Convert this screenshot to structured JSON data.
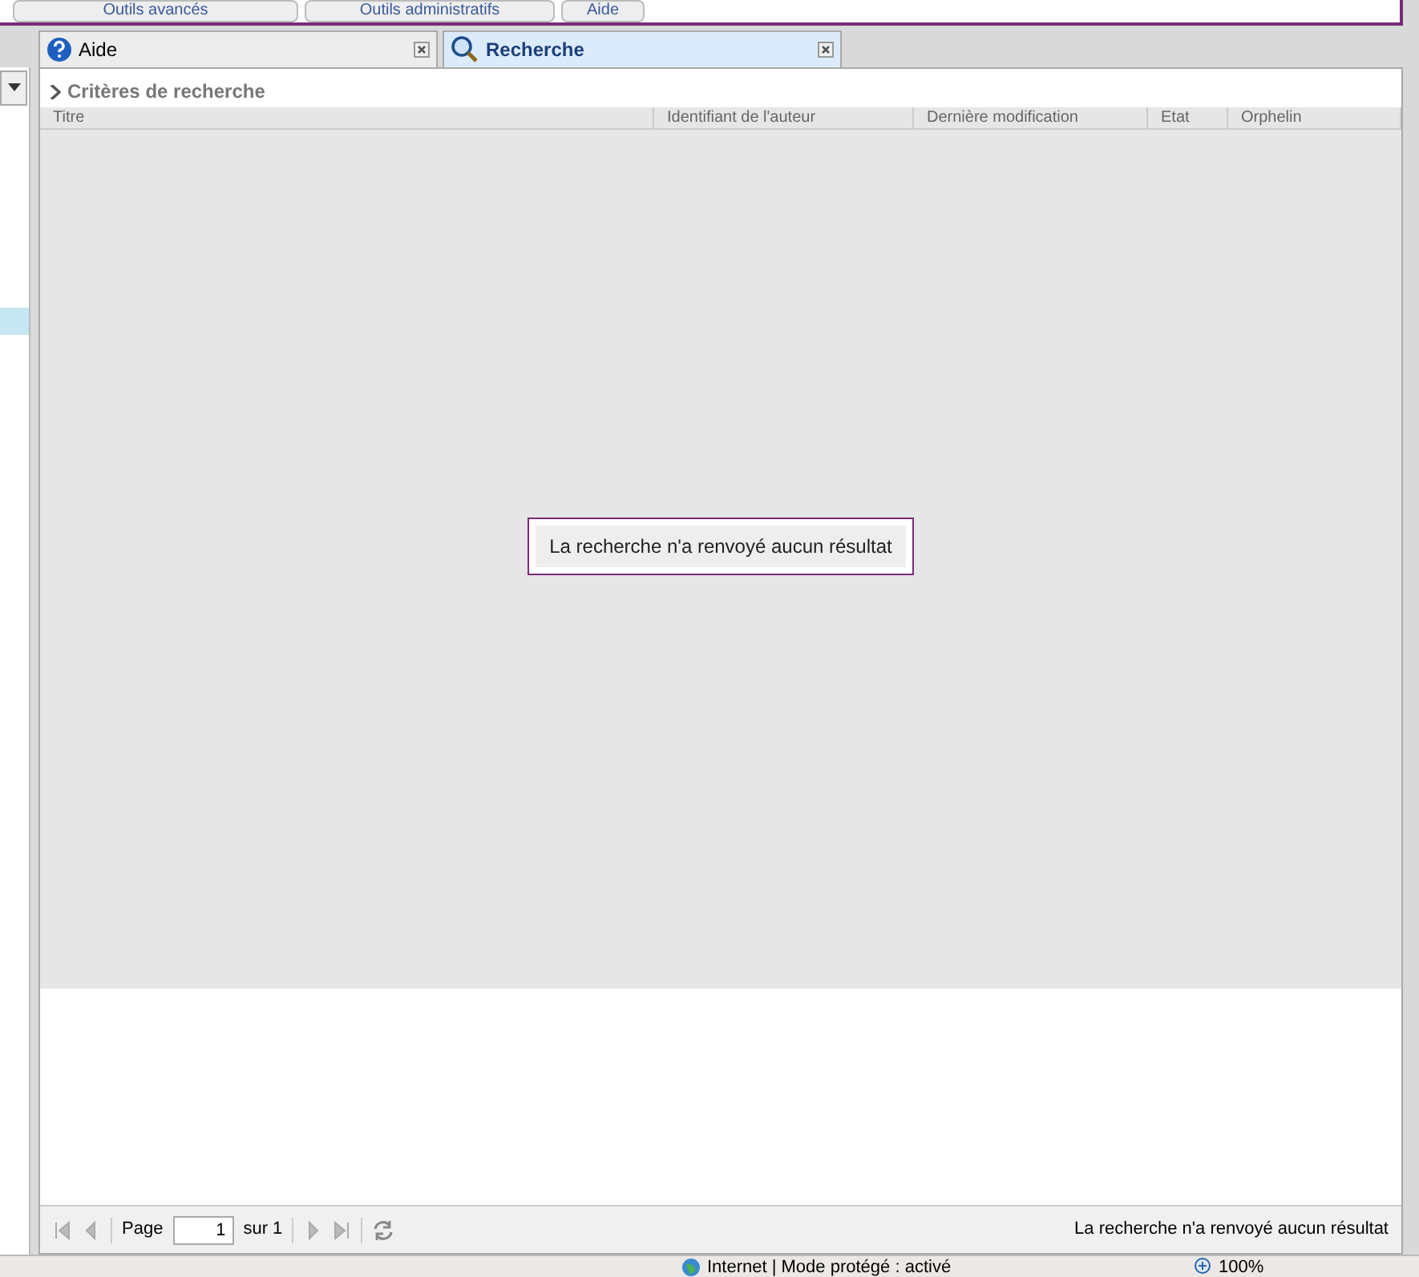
{
  "toolbar": {
    "buttons": [
      "Outils avancés",
      "Outils administratifs",
      "Aide"
    ]
  },
  "tabs": [
    {
      "label": "Aide",
      "kind": "help",
      "selected": false
    },
    {
      "label": "Recherche",
      "kind": "search",
      "selected": true
    }
  ],
  "criteria": {
    "label": "Critères de recherche",
    "expanded": false
  },
  "table": {
    "columns": [
      "Titre",
      "Identifiant de l'auteur",
      "Dernière modification",
      "Etat",
      "Orphelin"
    ],
    "empty_message": "La recherche n'a renvoyé aucun résultat"
  },
  "pager": {
    "page_label": "Page",
    "page": "1",
    "of_label": "sur 1",
    "summary": "La recherche n'a renvoyé aucun résultat"
  },
  "status_bar": {
    "zone": "Internet | Mode protégé : activé",
    "zoom": "100%"
  }
}
